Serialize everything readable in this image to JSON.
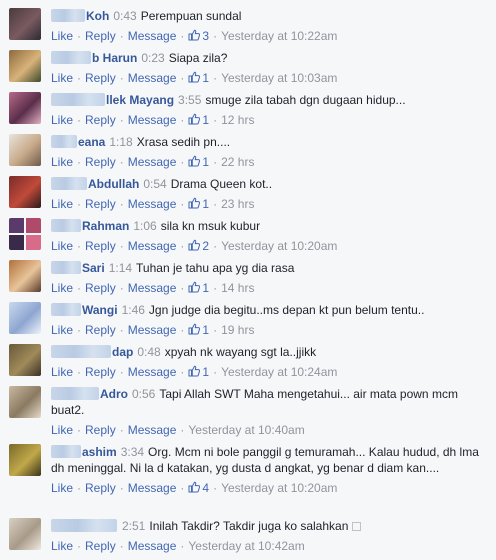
{
  "actions": {
    "like": "Like",
    "reply": "Reply",
    "message": "Message"
  },
  "comments": [
    {
      "name": "Koh",
      "duration": "0:43",
      "text": "Perempuan sundal",
      "likes": "3",
      "time": "Yesterday at 10:22am",
      "avatar": [
        "#4a3b3f",
        "#7a5a60",
        "#2d2a33"
      ]
    },
    {
      "name": "b Harun",
      "duration": "0:23",
      "text": "Siapa zila?",
      "likes": "1",
      "time": "Yesterday at 10:03am",
      "avatar": [
        "#8c6a3d",
        "#d8b27a",
        "#3d4a2a"
      ]
    },
    {
      "name": "llek Mayang",
      "duration": "3:55",
      "text": "smuge zila tabah dgn dugaan hidup...",
      "likes": "1",
      "time": "12 hrs",
      "avatar": [
        "#b86a8a",
        "#5a2e4a",
        "#e3b0c4"
      ]
    },
    {
      "name": "eana",
      "duration": "1:18",
      "text": "Xrasa sedih pn....",
      "likes": "1",
      "time": "22 hrs",
      "avatar": [
        "#e9e4dc",
        "#c7a98a",
        "#6e5a4a"
      ]
    },
    {
      "name": "Abdullah",
      "duration": "0:54",
      "text": "Drama Queen kot..",
      "likes": "1",
      "time": "23 hrs",
      "avatar": [
        "#7a2b2b",
        "#c04a3a",
        "#2b1a1a"
      ]
    },
    {
      "name": "Rahman",
      "duration": "1:06",
      "text": "sila kn msuk kubur",
      "likes": "2",
      "time": "Yesterday at 10:20am",
      "avatar": [
        "#5a3a6a",
        "#b04a6a",
        "#3a2a4a",
        "#d86a8a"
      ]
    },
    {
      "name": "Sari",
      "duration": "1:14",
      "text": "Tuhan je tahu apa yg dia rasa",
      "likes": "1",
      "time": "14 hrs",
      "avatar": [
        "#b0703a",
        "#e8c49a",
        "#5a3a2a"
      ]
    },
    {
      "name": "Wangi",
      "duration": "1:46",
      "text": "Jgn judge dia begitu..ms depan kt pun belum tentu..",
      "likes": "1",
      "time": "19 hrs",
      "avatar": [
        "#c9d8ee",
        "#8ea6d0",
        "#eef3fb"
      ]
    },
    {
      "name": "dap",
      "duration": "0:48",
      "text": "xpyah nk wayang sgt la..jjikk",
      "likes": "1",
      "time": "Yesterday at 10:24am",
      "avatar": [
        "#6a5a3a",
        "#a08a5a",
        "#3a3024"
      ]
    },
    {
      "name": "Adro",
      "duration": "0:56",
      "text": "Tapi Allah SWT Maha mengetahui... air mata pown mcm buat2.",
      "likes": "",
      "time": "Yesterday at 10:40am",
      "avatar": [
        "#c9b8a0",
        "#8a7a62",
        "#e6dccb"
      ]
    },
    {
      "name": "ashim",
      "duration": "3:34",
      "text": "Org. Mcm ni bole panggil g temuramah... Kalau hudud, dh lma dh meninggal. Ni la d katakan, yg dusta d angkat, yg benar d diam kan....",
      "likes": "4",
      "time": "Yesterday at 10:20am",
      "avatar": [
        "#7a6a2a",
        "#c0a84a",
        "#3a3418"
      ]
    },
    {
      "name": "",
      "duration": "2:51",
      "text": "Inilah Takdir? Takdir juga ko salahkan",
      "likes": "",
      "time": "Yesterday at 10:42am",
      "avatar": [
        "#d8d0c4",
        "#a89a88",
        "#efe9e0"
      ]
    }
  ]
}
